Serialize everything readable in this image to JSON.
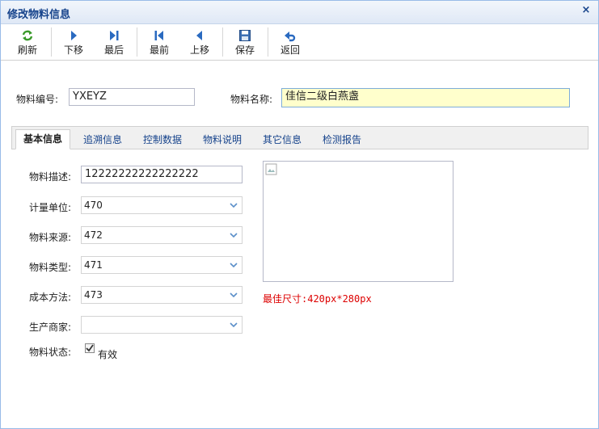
{
  "window": {
    "title": "修改物料信息",
    "close_glyph": "×"
  },
  "toolbar": {
    "refresh": "刷新",
    "next": "下移",
    "last": "最后",
    "first": "最前",
    "prev": "上移",
    "save": "保存",
    "back": "返回"
  },
  "header": {
    "code_label": "物料编号:",
    "code_value": "YXEYZ",
    "name_label": "物料名称:",
    "name_value": "佳信二级白燕盏"
  },
  "tabs": [
    "基本信息",
    "追溯信息",
    "控制数据",
    "物料说明",
    "其它信息",
    "检测报告"
  ],
  "form": {
    "desc_label": "物料描述:",
    "desc_value": "12222222222222222",
    "unit_label": "计量单位:",
    "unit_value": "470",
    "source_label": "物料来源:",
    "source_value": "472",
    "type_label": "物料类型:",
    "type_value": "471",
    "cost_label": "成本方法:",
    "cost_value": "473",
    "maker_label": "生产商家:",
    "maker_value": "",
    "status_label": "物料状态:",
    "status_checkbox_label": "有效",
    "status_checked": true
  },
  "image": {
    "hint": "最佳尺寸:420px*280px"
  },
  "colors": {
    "accent": "#15428b",
    "hint": "#dd0000",
    "highlight": "#ffffcc"
  },
  "icons": [
    "refresh-icon",
    "next-icon",
    "last-icon",
    "first-icon",
    "prev-icon",
    "save-icon",
    "back-icon",
    "chevron-down-icon",
    "close-icon",
    "checkmark-icon"
  ]
}
